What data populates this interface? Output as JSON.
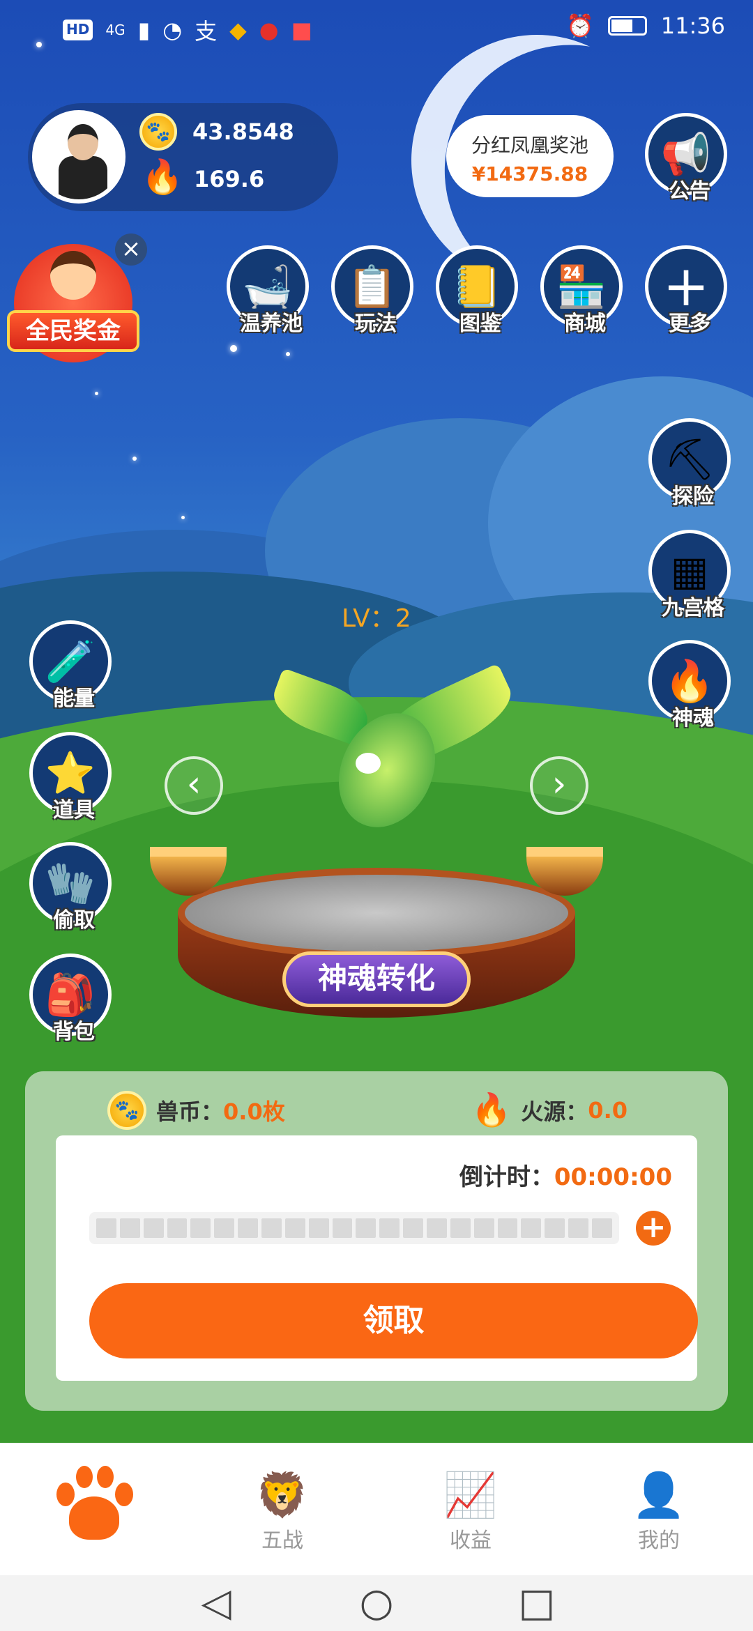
{
  "status_bar": {
    "network": "4G",
    "hd": "HD",
    "time": "11:36"
  },
  "profile": {
    "coins": "43.8548",
    "fire": "169.6"
  },
  "pool": {
    "title": "分红凤凰奖池",
    "amount": "¥14375.88"
  },
  "announce": {
    "label": "公告"
  },
  "promo": {
    "label": "全民奖金",
    "close": "×"
  },
  "top_menu": [
    {
      "label": "温养池",
      "icon": "pool-icon"
    },
    {
      "label": "玩法",
      "icon": "clipboard-icon"
    },
    {
      "label": "图鉴",
      "icon": "book-icon"
    },
    {
      "label": "商城",
      "icon": "shop-icon"
    },
    {
      "label": "更多",
      "icon": "plus-icon"
    }
  ],
  "right_menu": [
    {
      "label": "探险",
      "icon": "pickaxe-icon"
    },
    {
      "label": "九宫格",
      "icon": "grid-icon"
    },
    {
      "label": "神魂",
      "icon": "spirit-flame-icon"
    }
  ],
  "left_menu": [
    {
      "label": "能量",
      "icon": "potion-icon"
    },
    {
      "label": "道具",
      "icon": "star-icon"
    },
    {
      "label": "偷取",
      "icon": "glove-icon"
    },
    {
      "label": "背包",
      "icon": "backpack-icon"
    }
  ],
  "pet": {
    "level": "LV：2",
    "action": "神魂转化"
  },
  "panel": {
    "coin_label": "兽币：",
    "coin_value": "0.0枚",
    "fire_label": "火源：",
    "fire_value": "0.0",
    "countdown_label": "倒计时：",
    "countdown_value": "00:00:00",
    "progress": 0,
    "claim_label": "领取"
  },
  "tabs": [
    {
      "label": "",
      "icon": "paw-icon",
      "active": true
    },
    {
      "label": "五战",
      "icon": "lion-icon"
    },
    {
      "label": "收益",
      "icon": "chart-icon"
    },
    {
      "label": "我的",
      "icon": "user-icon"
    }
  ],
  "colors": {
    "accent": "#fa6714",
    "panel": "#a9d0a3",
    "sky": "#1c4cb6"
  }
}
